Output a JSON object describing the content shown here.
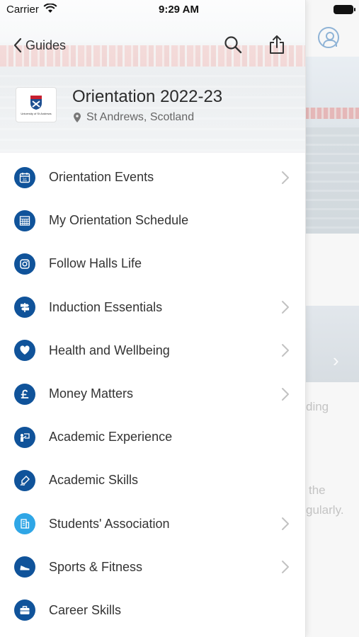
{
  "status_bar": {
    "carrier": "Carrier",
    "time": "9:29 AM"
  },
  "nav": {
    "back_label": "Guides"
  },
  "header": {
    "logo_text": "University of St Andrews",
    "title": "Orientation 2022-23",
    "location": "St Andrews, Scotland"
  },
  "menu": [
    {
      "label": "Orientation Events",
      "icon": "calendar-icon",
      "has_chevron": true
    },
    {
      "label": "My Orientation Schedule",
      "icon": "schedule-grid-icon",
      "has_chevron": false
    },
    {
      "label": "Follow Halls Life",
      "icon": "instagram-icon",
      "has_chevron": false
    },
    {
      "label": "Induction Essentials",
      "icon": "signpost-icon",
      "has_chevron": true
    },
    {
      "label": "Health and Wellbeing",
      "icon": "heart-icon",
      "has_chevron": true
    },
    {
      "label": "Money Matters",
      "icon": "pound-icon",
      "has_chevron": true
    },
    {
      "label": "Academic Experience",
      "icon": "presenter-icon",
      "has_chevron": false
    },
    {
      "label": "Academic Skills",
      "icon": "writing-icon",
      "has_chevron": false
    },
    {
      "label": "Students' Association",
      "icon": "building-icon",
      "has_chevron": true
    },
    {
      "label": "Sports & Fitness",
      "icon": "shoe-icon",
      "has_chevron": true
    },
    {
      "label": "Career Skills",
      "icon": "briefcase-icon",
      "has_chevron": false
    }
  ],
  "background_page": {
    "text_1": "ding",
    "text_2": "the",
    "text_3": "gularly."
  },
  "colors": {
    "icon_primary": "#10539a",
    "icon_light": "#2fa6e6",
    "avatar": "#8fb3d6"
  }
}
